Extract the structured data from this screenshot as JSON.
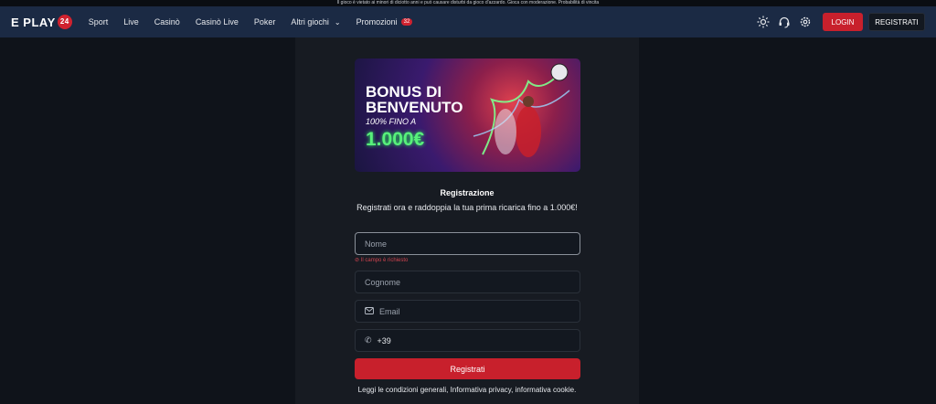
{
  "top_notice": "Il gioco è vietato ai minori di diciotto anni e può causare disturbi da gioco d'azzardo. Gioca con moderazione. Probabilità di vincita",
  "nav": {
    "logo_text": "E PLAY",
    "logo_badge": "24",
    "items": [
      "Sport",
      "Live",
      "Casinò",
      "Casinò Live",
      "Poker"
    ],
    "more_label": "Altri giochi",
    "promo_label": "Promozioni",
    "promo_count": "32",
    "login_label": "LOGIN",
    "register_label": "REGISTRATI"
  },
  "banner": {
    "title_line1": "BONUS DI",
    "title_line2": "BENVENUTO",
    "subtitle": "100% FINO A",
    "amount": "1.000€"
  },
  "form": {
    "heading": "Registrazione",
    "description": "Registrati ora e raddoppia la tua prima ricarica fino a 1.000€!",
    "name_placeholder": "Nome",
    "name_error": "Il campo è richiesto",
    "surname_placeholder": "Cognome",
    "email_placeholder": "Email",
    "phone_prefix": "+39",
    "submit_label": "Registrati",
    "legal_text": "Leggi le condizioni generali, Informativa privacy, informativa cookie."
  },
  "colors": {
    "nav_bg": "#1b2a44",
    "accent_red": "#c8202c",
    "bonus_green": "#58f07b"
  }
}
